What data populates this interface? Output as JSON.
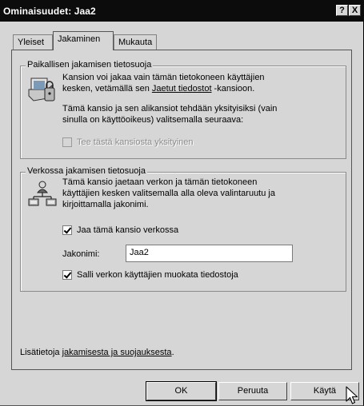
{
  "window": {
    "title": "Ominaisuudet: Jaa2",
    "help_button": "?",
    "close_button": "X"
  },
  "tabs": [
    {
      "label": "Yleiset"
    },
    {
      "label": "Jakaminen"
    },
    {
      "label": "Mukauta"
    }
  ],
  "local_sharing": {
    "legend": "Paikallisen jakamisen tietosuoja",
    "icon": "folder-security-icon",
    "text1_pre": "Kansion voi jakaa vain tämän tietokoneen käyttäjien",
    "text1_post_a": "kesken, vetämällä sen ",
    "text1_link": "Jaetut tiedostot",
    "text1_post_b": " -kansioon.",
    "text2_line1": "Tämä kansio ja sen alikansiot tehdään yksityisiksi (vain",
    "text2_line2": "sinulla on käyttöoikeus) valitsemalla seuraava:",
    "private_checkbox": {
      "label": "Tee tästä kansiosta yksityinen",
      "checked": false,
      "enabled": false
    }
  },
  "network_sharing": {
    "legend": "Verkossa jakamisen tietosuoja",
    "icon": "network-share-icon",
    "text_line1": "Tämä kansio jaetaan verkon ja tämän tietokoneen",
    "text_line2": "käyttäjien kesken valitsemalla alla oleva valintaruutu ja",
    "text_line3": "kirjoittamalla jakonimi.",
    "share_checkbox": {
      "label": "Jaa tämä kansio verkossa",
      "checked": true
    },
    "share_name_label": "Jakonimi:",
    "share_name_value": "Jaa2",
    "modify_checkbox": {
      "label": "Salli verkon käyttäjien muokata tiedostoja",
      "checked": true
    }
  },
  "info": {
    "prefix": "Lisätietoja ",
    "link": "jakamisesta ja suojauksesta",
    "suffix": "."
  },
  "buttons": {
    "ok": "OK",
    "cancel": "Peruuta",
    "apply": "Käytä"
  }
}
